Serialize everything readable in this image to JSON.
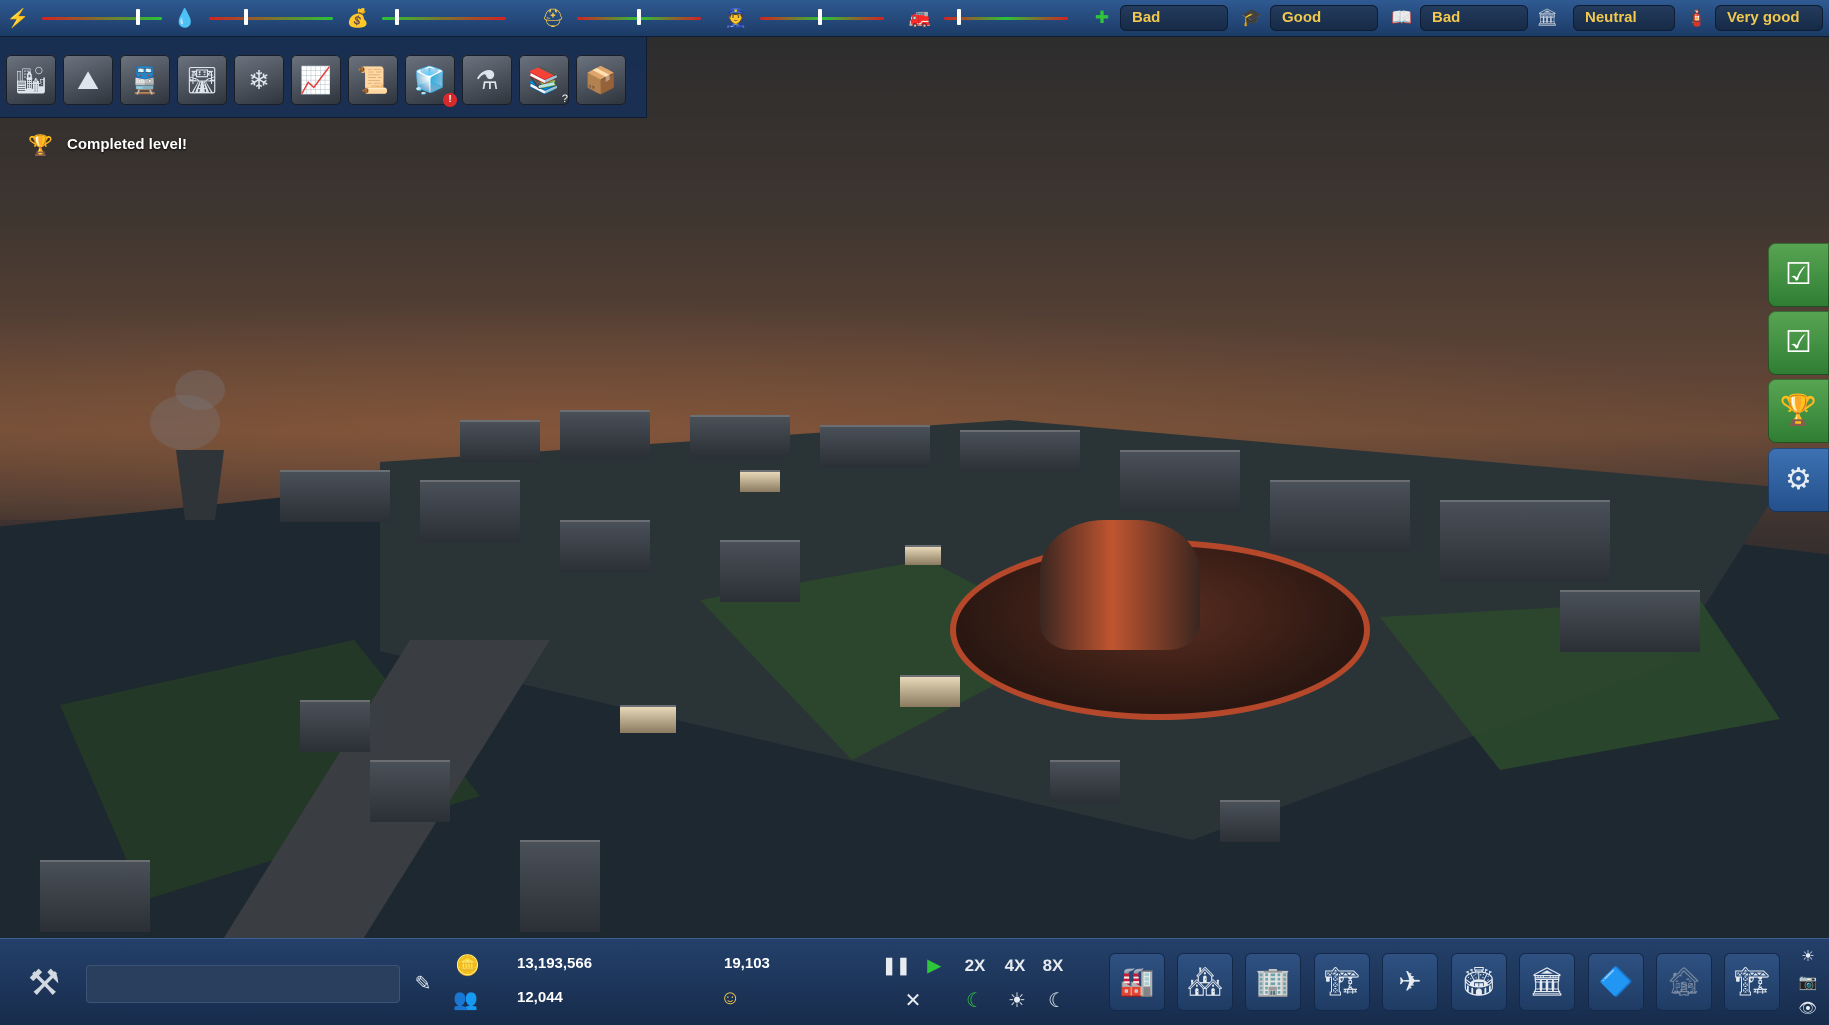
{
  "meters": [
    {
      "name": "power",
      "icon": "⚡",
      "icon_color": "#f5d442",
      "gradient": "g2r",
      "level_pct": 80
    },
    {
      "name": "water",
      "icon": "💧",
      "icon_color": "#4aa3ff",
      "gradient": "g2r",
      "level_pct": 30
    },
    {
      "name": "waste",
      "icon": "💰",
      "icon_color": "#c9ccd1",
      "gradient": "r2g",
      "level_pct": 12
    },
    {
      "name": "employment",
      "icon": "⛑",
      "icon_color": "#f2c94c",
      "gradient": "rgr",
      "level_pct": 50
    },
    {
      "name": "police",
      "icon": "👮",
      "icon_color": "#c9ccd1",
      "gradient": "rgr",
      "level_pct": 48
    },
    {
      "name": "fire",
      "icon": "🚒",
      "icon_color": "#c9ccd1",
      "gradient": "rgr",
      "level_pct": 12
    }
  ],
  "statuses": [
    {
      "name": "health",
      "icon": "✚",
      "value": "Bad"
    },
    {
      "name": "education",
      "icon": "🎓",
      "value": "Good"
    },
    {
      "name": "tourism",
      "icon": "📖",
      "value": "Bad"
    },
    {
      "name": "environment",
      "icon": "🏛",
      "value": "Neutral"
    },
    {
      "name": "safety",
      "icon": "🧯",
      "value": "Very good"
    }
  ],
  "tools": [
    {
      "name": "residential-zone",
      "icon": "🏙"
    },
    {
      "name": "terrain",
      "icon": "⛰"
    },
    {
      "name": "transport",
      "icon": "🚆"
    },
    {
      "name": "roads",
      "icon": "🛣"
    },
    {
      "name": "utilities",
      "icon": "❄"
    },
    {
      "name": "statistics",
      "icon": "📈"
    },
    {
      "name": "policies",
      "icon": "📜"
    },
    {
      "name": "alerts",
      "icon": "🧊",
      "badge": "!"
    },
    {
      "name": "research",
      "icon": "⚗"
    },
    {
      "name": "help-library",
      "icon": "📚",
      "qbadge": "?"
    },
    {
      "name": "crates",
      "icon": "📦"
    }
  ],
  "notice": {
    "text": "Completed level!"
  },
  "side_buttons": [
    {
      "name": "objective-check-1",
      "icon": "☑",
      "style": "green"
    },
    {
      "name": "objective-check-2",
      "icon": "☑",
      "style": "green"
    },
    {
      "name": "achievements",
      "icon": "🏆",
      "style": "green"
    },
    {
      "name": "settings",
      "icon": "⚙",
      "style": "blue"
    }
  ],
  "bottom": {
    "city_name_value": "",
    "money": "13,193,566",
    "income": "19,103",
    "population": "12,044",
    "speeds": [
      "2X",
      "4X",
      "8X"
    ],
    "build_categories": [
      {
        "name": "power-plants",
        "icon": "🏭",
        "disabled": false
      },
      {
        "name": "residential-buildings",
        "icon": "🏘",
        "disabled": false
      },
      {
        "name": "commercial-buildings",
        "icon": "🏢",
        "disabled": false
      },
      {
        "name": "industrial-buildings",
        "icon": "🏗",
        "disabled": false
      },
      {
        "name": "airport-runway",
        "icon": "✈",
        "disabled": false
      },
      {
        "name": "stadium",
        "icon": "🏟",
        "disabled": false
      },
      {
        "name": "government-buildings",
        "icon": "🏛",
        "disabled": false
      },
      {
        "name": "glass-pyramid",
        "icon": "🔷",
        "disabled": false
      },
      {
        "name": "warehouses",
        "icon": "🏚",
        "disabled": true
      },
      {
        "name": "harbor-crane",
        "icon": "🏗",
        "disabled": false
      }
    ]
  }
}
